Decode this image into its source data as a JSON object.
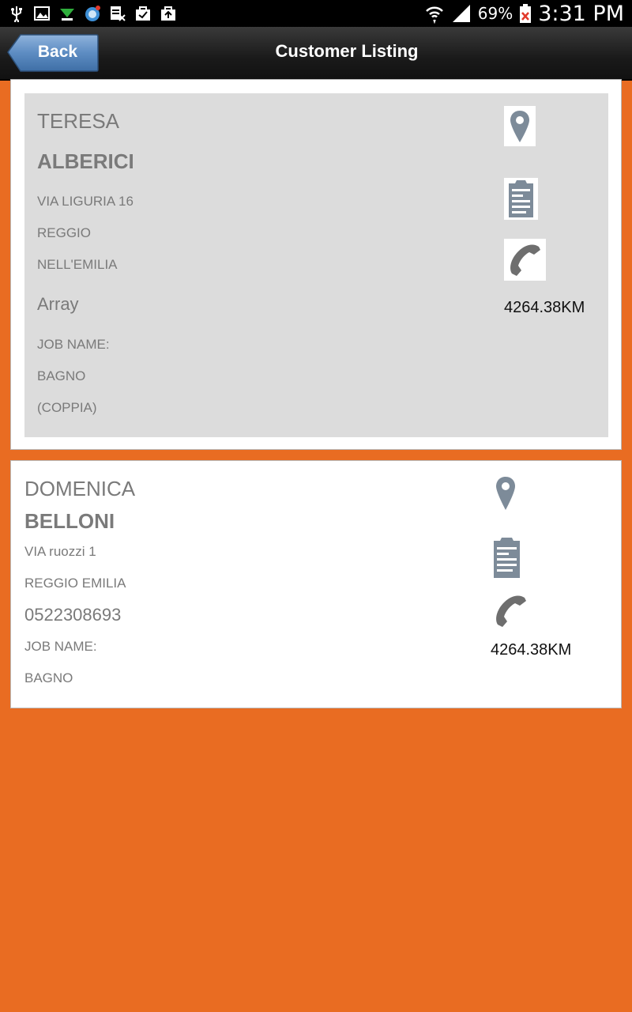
{
  "status_bar": {
    "battery": "69%",
    "time": "3:31 PM"
  },
  "header": {
    "back_label": "Back",
    "title": "Customer Listing"
  },
  "customers": [
    {
      "first_name": "TERESA",
      "last_name": "ALBERICI",
      "address_line1": "VIA LIGURIA 16",
      "city_line1": "REGGIO",
      "city_line2": "NELL'EMILIA",
      "phone": "Array",
      "job_label": "JOB NAME:",
      "job_line1": "BAGNO",
      "job_line2": "(COPPIA)",
      "distance": "4264.38KM"
    },
    {
      "first_name": "DOMENICA",
      "last_name": "BELLONI",
      "address_line1": "VIA ruozzi 1",
      "city_line1": "REGGIO EMILIA",
      "phone": "0522308693",
      "job_label": "JOB NAME:",
      "job_line1": "BAGNO",
      "distance": "4264.38KM"
    }
  ],
  "icons": {
    "map": "map-pin-icon",
    "notes": "notes-icon",
    "phone": "phone-icon"
  },
  "colors": {
    "background": "#e96c22",
    "header": "#1a1a1a",
    "back_button": "#4d7fb5",
    "card_selected": "#dcdcdc",
    "icon_gray": "#7d8b99"
  }
}
